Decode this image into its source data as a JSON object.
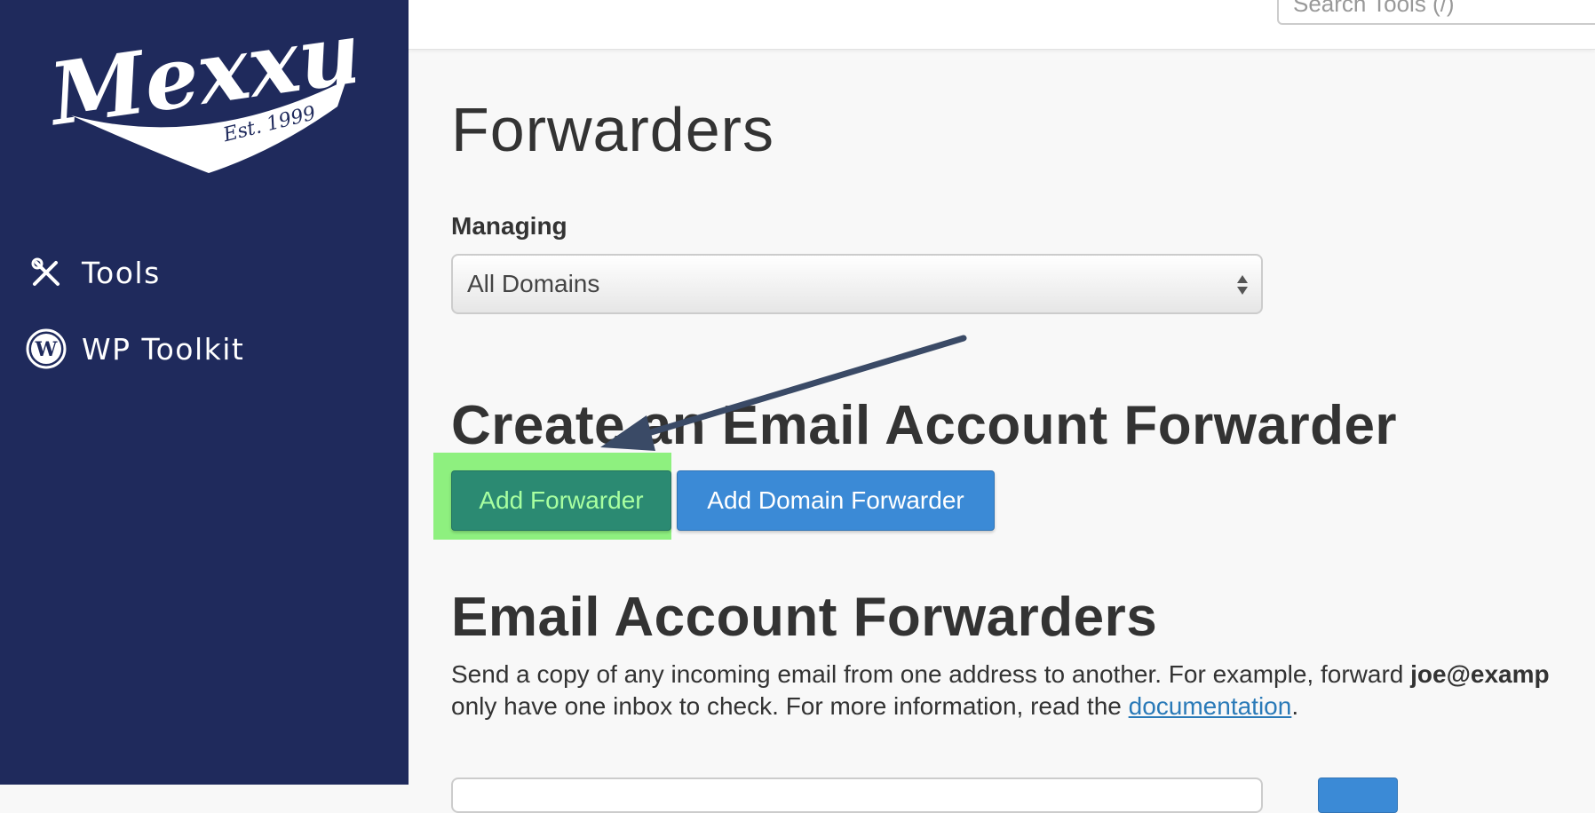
{
  "brand": {
    "logo_text": "Mexxus",
    "logo_tagline": "Est. 1999"
  },
  "sidebar": {
    "items": [
      {
        "label": "Tools",
        "icon": "tools-icon"
      },
      {
        "label": "WP Toolkit",
        "icon": "wordpress-icon"
      }
    ]
  },
  "topbar": {
    "search_text": "Search Tools (/)"
  },
  "main": {
    "title": "Forwarders",
    "managing_label": "Managing",
    "managing_value": "All Domains",
    "create_heading": "Create an Email Account Forwarder",
    "add_forwarder_label": "Add Forwarder",
    "add_domain_forwarder_label": "Add Domain Forwarder",
    "list_heading": "Email Account Forwarders",
    "description": {
      "line1_prefix": "Send a copy of any incoming email from one address to another. For example, forward ",
      "line1_bold": "joe@examp",
      "line2_prefix": "only have one inbox to check. For more information, read the ",
      "link_text": "documentation",
      "line2_suffix": "."
    }
  },
  "colors": {
    "sidebar_bg": "#1f2a5c",
    "add_button": "#2b8a72",
    "domain_button": "#3b8ad6",
    "highlight": "#8ef07f",
    "annotation_arrow": "#3a4a66"
  }
}
